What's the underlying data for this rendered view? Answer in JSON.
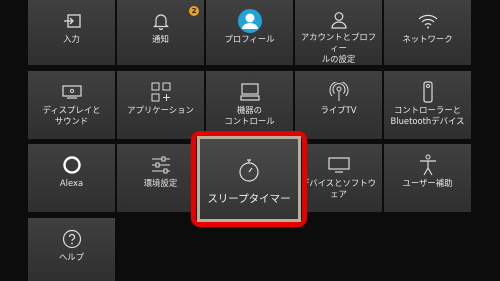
{
  "tiles": [
    {
      "key": "input",
      "label": "入力",
      "icon": "input-icon"
    },
    {
      "key": "notifications",
      "label": "通知",
      "icon": "bell-icon",
      "badge": "2"
    },
    {
      "key": "profiles",
      "label": "プロフィール",
      "icon": "avatar-icon"
    },
    {
      "key": "account",
      "label": "アカウントとプロフィー\nルの設定",
      "icon": "person-icon"
    },
    {
      "key": "network",
      "label": "ネットワーク",
      "icon": "wifi-icon"
    },
    {
      "key": "display",
      "label": "ディスプレイと\nサウンド",
      "icon": "display-icon"
    },
    {
      "key": "applications",
      "label": "アプリケーション",
      "icon": "apps-icon"
    },
    {
      "key": "equipment",
      "label": "機器の\nコントロール",
      "icon": "tv-control-icon"
    },
    {
      "key": "livetv",
      "label": "ライブTV",
      "icon": "antenna-icon"
    },
    {
      "key": "controllers",
      "label": "コントローラーと\nBluetoothデバイス",
      "icon": "remote-icon"
    },
    {
      "key": "alexa",
      "label": "Alexa",
      "icon": "alexa-icon"
    },
    {
      "key": "preferences",
      "label": "環境設定",
      "icon": "sliders-icon"
    },
    {
      "key": "sleep",
      "label": "スリープタイマー",
      "icon": "stopwatch-icon",
      "focused": true
    },
    {
      "key": "device",
      "label": "デバイスとソフトウェア",
      "icon": "monitor-icon"
    },
    {
      "key": "accessibility",
      "label": "ユーザー補助",
      "icon": "accessibility-icon"
    },
    {
      "key": "help",
      "label": "ヘルプ",
      "icon": "help-icon"
    }
  ],
  "colors": {
    "focus_ring": "#e60000",
    "badge": "#f0a21d",
    "avatar": "#1fa3d8"
  }
}
